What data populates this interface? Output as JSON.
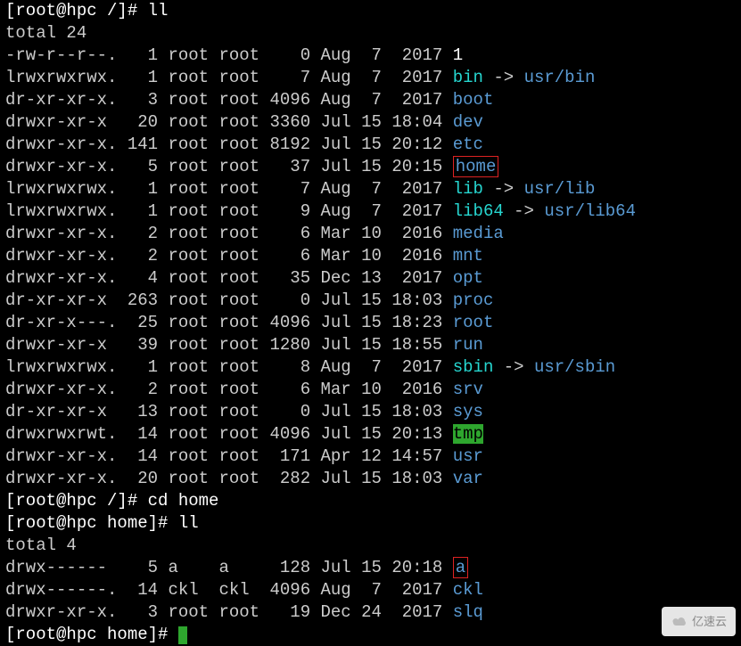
{
  "prompts": {
    "p1": "[root@hpc /]# ",
    "p2": "[root@hpc /]# ",
    "p3": "[root@hpc home]# ",
    "p4": "[root@hpc home]# "
  },
  "commands": {
    "c1": "ll",
    "c2": "cd home",
    "c3": "ll"
  },
  "totals": {
    "t1": "total 24",
    "t2": "total 4"
  },
  "listing1": [
    {
      "perm": "-rw-r--r--.",
      "links": "1",
      "owner": "root",
      "group": "root",
      "size": "0",
      "date": "Aug  7  2017",
      "name": "1",
      "type": "file"
    },
    {
      "perm": "lrwxrwxrwx.",
      "links": "1",
      "owner": "root",
      "group": "root",
      "size": "7",
      "date": "Aug  7  2017",
      "name": "bin",
      "type": "link",
      "target": "usr/bin"
    },
    {
      "perm": "dr-xr-xr-x.",
      "links": "3",
      "owner": "root",
      "group": "root",
      "size": "4096",
      "date": "Aug  7  2017",
      "name": "boot",
      "type": "dir"
    },
    {
      "perm": "drwxr-xr-x",
      "links": "20",
      "owner": "root",
      "group": "root",
      "size": "3360",
      "date": "Jul 15 18:04",
      "name": "dev",
      "type": "dir"
    },
    {
      "perm": "drwxr-xr-x.",
      "links": "141",
      "owner": "root",
      "group": "root",
      "size": "8192",
      "date": "Jul 15 20:12",
      "name": "etc",
      "type": "dir"
    },
    {
      "perm": "drwxr-xr-x.",
      "links": "5",
      "owner": "root",
      "group": "root",
      "size": "37",
      "date": "Jul 15 20:15",
      "name": "home",
      "type": "dir",
      "boxed": true
    },
    {
      "perm": "lrwxrwxrwx.",
      "links": "1",
      "owner": "root",
      "group": "root",
      "size": "7",
      "date": "Aug  7  2017",
      "name": "lib",
      "type": "link",
      "target": "usr/lib"
    },
    {
      "perm": "lrwxrwxrwx.",
      "links": "1",
      "owner": "root",
      "group": "root",
      "size": "9",
      "date": "Aug  7  2017",
      "name": "lib64",
      "type": "link",
      "target": "usr/lib64"
    },
    {
      "perm": "drwxr-xr-x.",
      "links": "2",
      "owner": "root",
      "group": "root",
      "size": "6",
      "date": "Mar 10  2016",
      "name": "media",
      "type": "dir"
    },
    {
      "perm": "drwxr-xr-x.",
      "links": "2",
      "owner": "root",
      "group": "root",
      "size": "6",
      "date": "Mar 10  2016",
      "name": "mnt",
      "type": "dir"
    },
    {
      "perm": "drwxr-xr-x.",
      "links": "4",
      "owner": "root",
      "group": "root",
      "size": "35",
      "date": "Dec 13  2017",
      "name": "opt",
      "type": "dir"
    },
    {
      "perm": "dr-xr-xr-x",
      "links": "263",
      "owner": "root",
      "group": "root",
      "size": "0",
      "date": "Jul 15 18:03",
      "name": "proc",
      "type": "dir"
    },
    {
      "perm": "dr-xr-x---.",
      "links": "25",
      "owner": "root",
      "group": "root",
      "size": "4096",
      "date": "Jul 15 18:23",
      "name": "root",
      "type": "dir"
    },
    {
      "perm": "drwxr-xr-x",
      "links": "39",
      "owner": "root",
      "group": "root",
      "size": "1280",
      "date": "Jul 15 18:55",
      "name": "run",
      "type": "dir"
    },
    {
      "perm": "lrwxrwxrwx.",
      "links": "1",
      "owner": "root",
      "group": "root",
      "size": "8",
      "date": "Aug  7  2017",
      "name": "sbin",
      "type": "link",
      "target": "usr/sbin"
    },
    {
      "perm": "drwxr-xr-x.",
      "links": "2",
      "owner": "root",
      "group": "root",
      "size": "6",
      "date": "Mar 10  2016",
      "name": "srv",
      "type": "dir"
    },
    {
      "perm": "dr-xr-xr-x",
      "links": "13",
      "owner": "root",
      "group": "root",
      "size": "0",
      "date": "Jul 15 18:03",
      "name": "sys",
      "type": "dir"
    },
    {
      "perm": "drwxrwxrwt.",
      "links": "14",
      "owner": "root",
      "group": "root",
      "size": "4096",
      "date": "Jul 15 20:13",
      "name": "tmp",
      "type": "sticky"
    },
    {
      "perm": "drwxr-xr-x.",
      "links": "14",
      "owner": "root",
      "group": "root",
      "size": "171",
      "date": "Apr 12 14:57",
      "name": "usr",
      "type": "dir"
    },
    {
      "perm": "drwxr-xr-x.",
      "links": "20",
      "owner": "root",
      "group": "root",
      "size": "282",
      "date": "Jul 15 18:03",
      "name": "var",
      "type": "dir"
    }
  ],
  "listing2": [
    {
      "perm": "drwx------",
      "links": "5",
      "owner": "a",
      "group": "a",
      "size": "128",
      "date": "Jul 15 20:18",
      "name": "a",
      "type": "dir",
      "boxed": true
    },
    {
      "perm": "drwx------.",
      "links": "14",
      "owner": "ckl",
      "group": "ckl",
      "size": "4096",
      "date": "Aug  7  2017",
      "name": "ckl",
      "type": "dir"
    },
    {
      "perm": "drwxr-xr-x.",
      "links": "3",
      "owner": "root",
      "group": "root",
      "size": "19",
      "date": "Dec 24  2017",
      "name": "slq",
      "type": "dir"
    }
  ],
  "arrow": " -> ",
  "watermark": "亿速云"
}
